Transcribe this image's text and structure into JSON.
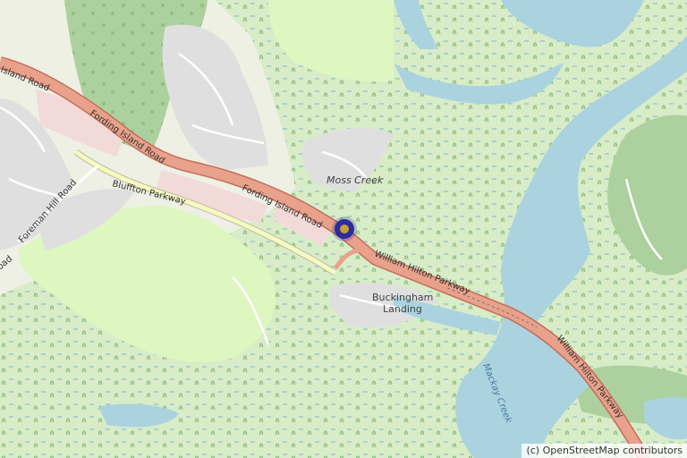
{
  "map": {
    "attribution": "(c) OpenStreetMap contributors",
    "labels": {
      "fording_island_road_left": "Island Road",
      "fording_island_road_mid": "Fording Island Road",
      "fording_island_road_right": "Fording Island Road",
      "bluffton_parkway": "Bluffton Parkway",
      "foreman_hill_road": "Foreman Hill Road",
      "road_left": "oad",
      "william_hilton_parkway_1": "William Hilton Parkway",
      "william_hilton_parkway_2": "William Hilton Parkway",
      "moss_creek": "Moss Creek",
      "buckingham_landing_1": "Buckingham",
      "buckingham_landing_2": "Landing",
      "mackay_creek": "Mackay Creek"
    },
    "colors": {
      "background": "#eef0e4",
      "wetland": "#d8ecc8",
      "water": "#aad3df",
      "forest": "#add19e",
      "golf": "#def6c0",
      "residential": "#e0dfdf",
      "commercial": "#f2dad9",
      "main_road": "#e8a18a",
      "secondary_road": "#f7fabf",
      "marker": "#2c2c9c",
      "marker_center": "#c8a030"
    }
  }
}
